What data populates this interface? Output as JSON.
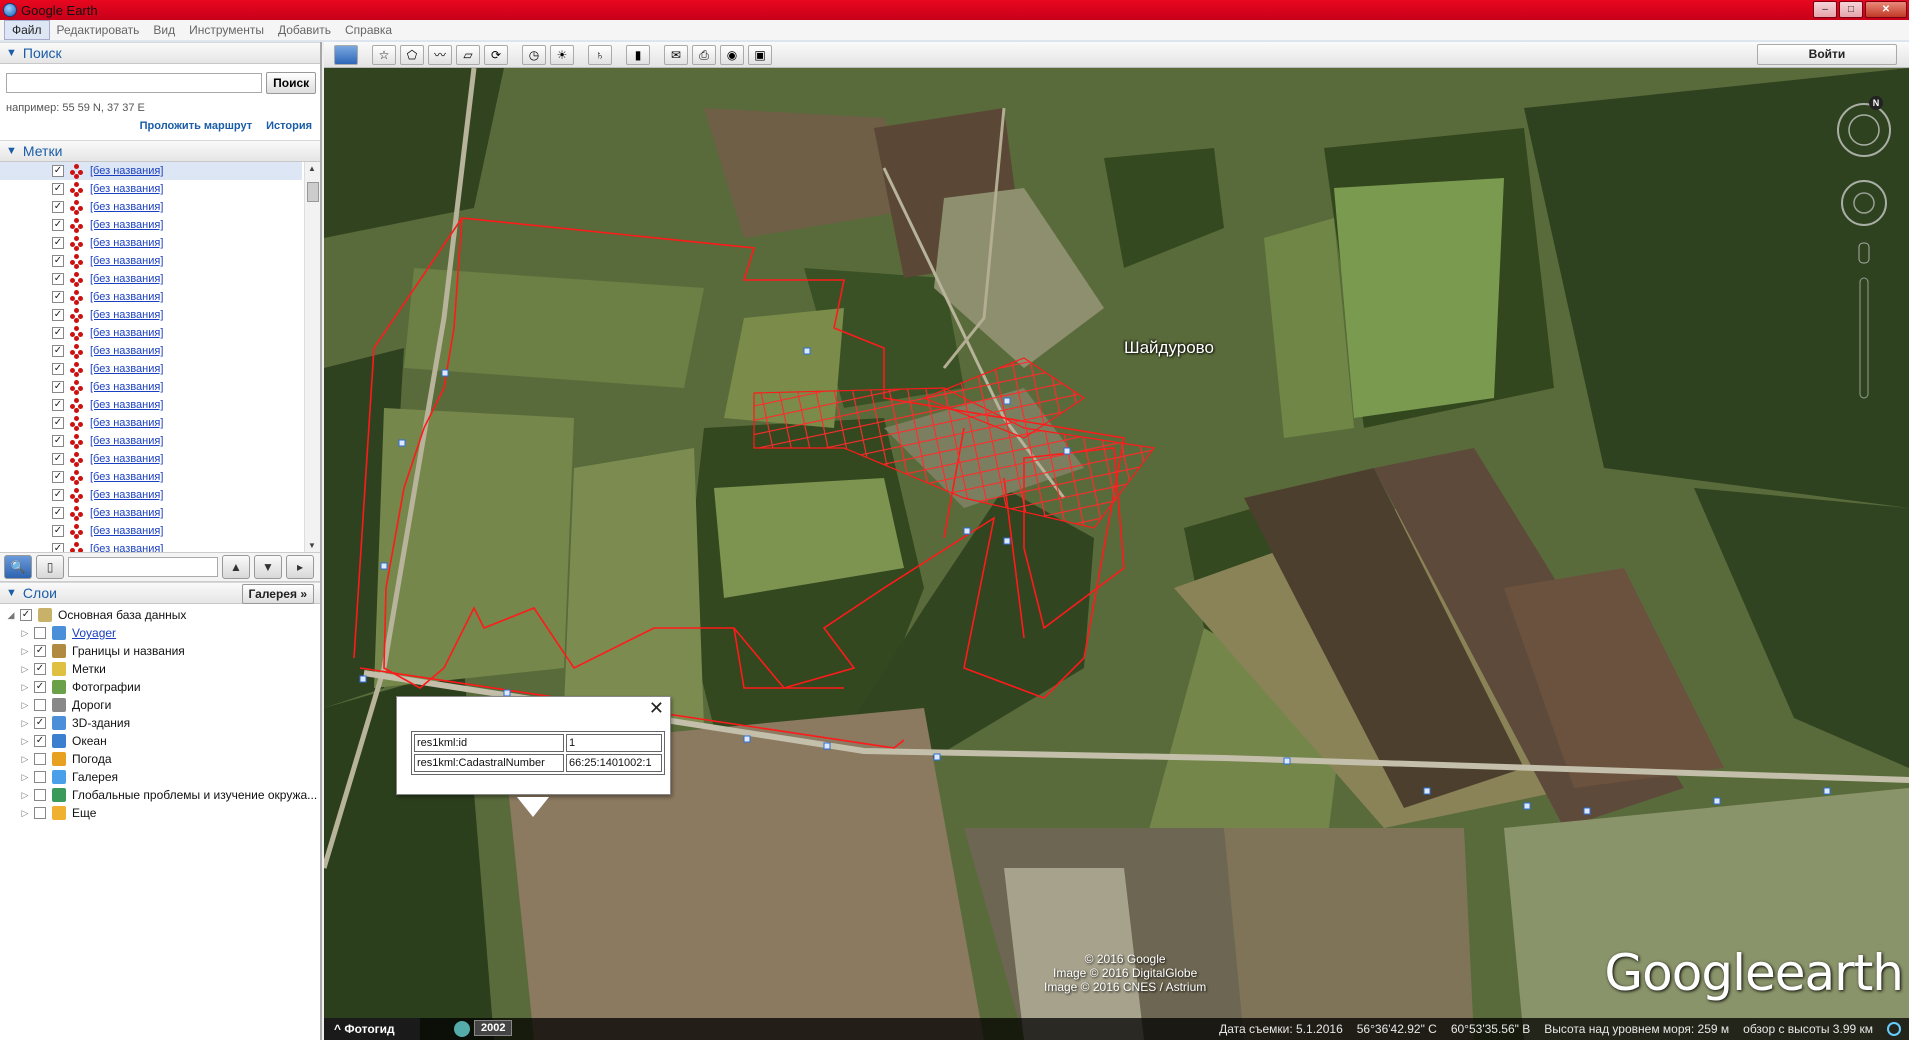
{
  "window": {
    "title": "Google Earth",
    "buttons": [
      "–",
      "□",
      "✕"
    ]
  },
  "menu": [
    "Файл",
    "Редактировать",
    "Вид",
    "Инструменты",
    "Добавить",
    "Справка"
  ],
  "search": {
    "section_label": "Поиск",
    "button": "Поиск",
    "hint": "например: 55 59 N, 37 37 E",
    "route_link": "Проложить маршрут",
    "history_link": "История"
  },
  "places": {
    "section_label": "Метки",
    "item_label": "[без названия]",
    "items_count": 22
  },
  "layers": {
    "section_label": "Слои",
    "gallery_button": "Галерея",
    "items": [
      {
        "label": "Основная база данных",
        "checked": true,
        "link": false
      },
      {
        "label": "Voyager",
        "checked": false,
        "link": true
      },
      {
        "label": "Границы и названия",
        "checked": true,
        "link": false
      },
      {
        "label": "Метки",
        "checked": true,
        "link": false
      },
      {
        "label": "Фотографии",
        "checked": true,
        "link": false
      },
      {
        "label": "Дороги",
        "checked": false,
        "link": false
      },
      {
        "label": "3D-здания",
        "checked": true,
        "link": false
      },
      {
        "label": "Океан",
        "checked": true,
        "link": false
      },
      {
        "label": "Погода",
        "checked": false,
        "link": false
      },
      {
        "label": "Галерея",
        "checked": false,
        "link": false
      },
      {
        "label": "Глобальные проблемы и изучение окружа...",
        "checked": false,
        "link": false
      },
      {
        "label": "Еще",
        "checked": false,
        "link": false
      }
    ]
  },
  "top_toolbar": {
    "signin": "Войти"
  },
  "map": {
    "village_label": "Шайдурово",
    "credits": [
      "© 2016 Google",
      "Image © 2016 DigitalGlobe",
      "Image © 2016 CNES / Astrium"
    ],
    "logo_brand": "Google",
    "logo_product": "earth",
    "compass_n": "N"
  },
  "balloon": {
    "rows": [
      {
        "key": "res1kml:id",
        "value": "1"
      },
      {
        "key": "res1kml:CadastralNumber",
        "value": "66:25:1401002:1"
      }
    ],
    "close": "✕"
  },
  "status": {
    "photo_tab": "Фотогид",
    "year": "2002",
    "date": "Дата съемки: 5.1.2016",
    "lat": "56°36'42.92\" С",
    "lon": "60°53'35.56\" В",
    "alt": "Высота над уровнем моря:  259 м",
    "eye": "обзор с высоты  3.99 км"
  },
  "colors": {
    "boundary": "#ff1a1a",
    "accent": "#1a5da8"
  }
}
